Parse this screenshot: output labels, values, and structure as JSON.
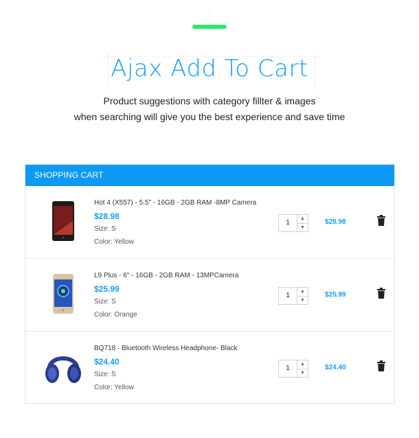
{
  "hero": {
    "title": "Ajax Add To Cart",
    "subtitle_line1": "Product suggestions with category fillter & images",
    "subtitle_line2": "when searching will give you the best experience and save time",
    "accent_color": "#2ee86a",
    "title_color": "#1a9cf5"
  },
  "cart": {
    "header": "SHOPPING CART",
    "header_color": "#0d99f6",
    "price_color": "#1a9cf5",
    "items": [
      {
        "name": "Hot 4 (X557) - 5.5\" - 16GB - 2GB RAM -8MP Camera",
        "price": "$28.98",
        "size": "Size: S",
        "color": "Color: Yellow",
        "quantity": "1",
        "line_total": "$28.98",
        "image_icon": "black-smartphone-icon"
      },
      {
        "name": "L9 Plus - 6\" - 16GB - 2GB RAM - 13MPCamera",
        "price": "$25.99",
        "size": "Size: S",
        "color": "Color: Orange",
        "quantity": "1",
        "line_total": "$25.99",
        "image_icon": "gold-smartphone-icon"
      },
      {
        "name": "BQ718 - Bluetooth Wireless Headphone- Black",
        "price": "$24.40",
        "size": "Size: S",
        "color": "Color: Yellow",
        "quantity": "1",
        "line_total": "$24.40",
        "image_icon": "headphones-icon"
      }
    ]
  }
}
